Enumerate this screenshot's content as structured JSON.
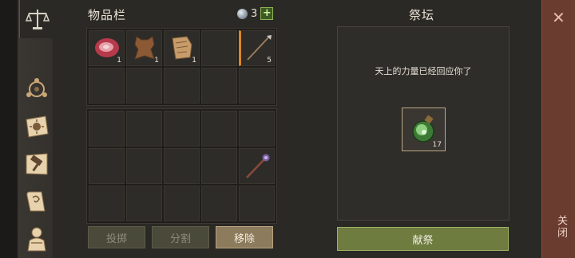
{
  "inventory": {
    "title": "物品栏",
    "currency_amount": "3",
    "slots_top": [
      {
        "icon": "raw-meat-icon",
        "qty": "1"
      },
      {
        "icon": "leather-hide-icon",
        "qty": "1"
      },
      {
        "icon": "leather-scroll-icon",
        "qty": "1"
      },
      {
        "icon": "",
        "qty": ""
      },
      {
        "icon": "spear-icon",
        "qty": "5",
        "equipped": true
      }
    ],
    "slots_bottom_weapon": {
      "icon": "mace-icon",
      "qty": ""
    }
  },
  "actions": {
    "throw_label": "投掷",
    "split_label": "分割",
    "remove_label": "移除"
  },
  "altar": {
    "title": "祭坛",
    "message": "天上的力量已经回应你了",
    "item": {
      "icon": "green-potion-icon",
      "qty": "17"
    },
    "offer_label": "献祭"
  },
  "close": {
    "label": "关闭"
  },
  "colors": {
    "accent_green": "#6e7c40",
    "close_red": "#6a3b2f",
    "equip_orange": "#d9862a"
  }
}
